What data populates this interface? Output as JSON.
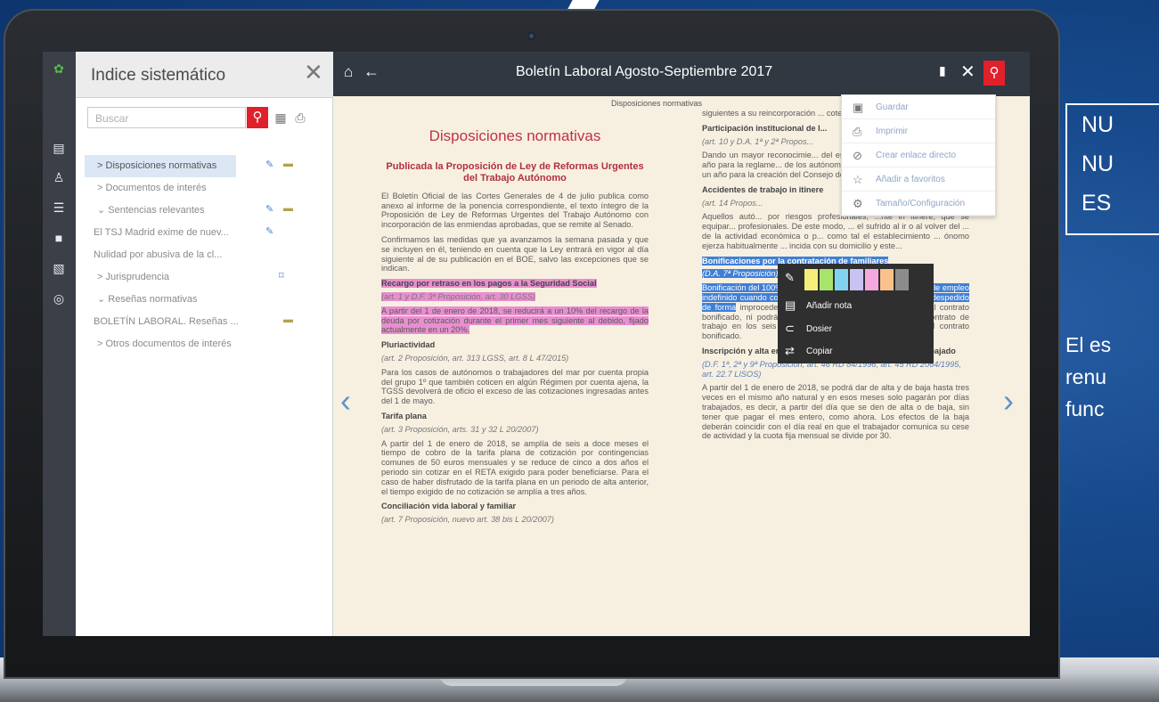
{
  "app": {
    "sidebar_title": "Indice sistemático",
    "doc_title": "Boletín Laboral Agosto-Septiembre 2017",
    "search_placeholder": "Buscar"
  },
  "tree": [
    {
      "label": "Disposiciones normativas",
      "prefix": ">"
    },
    {
      "label": "Documentos de interés",
      "prefix": ">"
    },
    {
      "label": "Sentencias relevantes",
      "prefix": "⌄"
    },
    {
      "label": "El TSJ Madrid exime de nuev...",
      "prefix": ""
    },
    {
      "label": "Nulidad por abusiva de la cl...",
      "prefix": ""
    },
    {
      "label": "Jurisprudencia",
      "prefix": ">"
    },
    {
      "label": "Reseñas normativas",
      "prefix": "⌄"
    },
    {
      "label": "BOLETÍN LABORAL. Reseñas ...",
      "prefix": ""
    },
    {
      "label": "Otros documentos de interés",
      "prefix": ">"
    }
  ],
  "doc": {
    "running_header": "Disposiciones normativas",
    "heading": "Disposiciones normativas",
    "subheading": "Publicada la Proposición de Ley de Reformas Urgentes del Trabajo Autónomo",
    "p1": "El Boletín Oficial de las Cortes Generales de 4 de julio publica como anexo al informe de la ponencia correspondiente, el texto íntegro de la Proposición de Ley de Reformas Urgentes del Trabajo Autónomo con incorporación de las enmiendas aprobadas, que se remite al Senado.",
    "p2": "Confirmamos las medidas que ya avanzamos la semana pasada y que se incluyen en él, teniendo en cuenta que la Ley entrará en vigor al día siguiente al de su publicación en el BOE, salvo las excepciones que se indican.",
    "h_recargo": "Recargo por retraso en los pagos a la Seguridad Social",
    "ref_recargo": "(art. 1 y D.F. 3ª Proposición, art. 30 LGSS)",
    "p_recargo": "A partir del 1 de enero de 2018, se reducirá a un 10% del recargo de la deuda por cotización durante el primer mes siguiente al debido, fijado actualmente en un 20%.",
    "h_pluri": "Pluriactividad",
    "ref_pluri": "(art. 2 Proposición, art. 313 LGSS, art. 8 L 47/2015)",
    "p_pluri": "Para los casos de autónomos o trabajadores del mar por cuenta propia del grupo 1º que también coticen en algún Régimen por cuenta ajena, la TGSS devolverá de oficio el exceso de las cotizaciones ingresadas antes del 1 de mayo.",
    "h_tarifa": "Tarifa plana",
    "ref_tarifa": "(art. 3 Proposición, arts. 31 y 32 L 20/2007)",
    "p_tarifa": "A partir del 1 de enero de 2018, se amplía de seis a doce meses el tiempo de cobro de la tarifa plana de cotización por contingencias comunes de 50 euros mensuales y se reduce de cinco a dos años el periodo sin cotizar en el RETA exigido para poder beneficiarse. Para el caso de haber disfrutado de la tarifa plana en un periodo de alta anterior, el tiempo exigido de no cotización se amplía a tres años.",
    "h_concil": "Conciliación vida laboral y familiar",
    "ref_concil": "(art. 7 Proposición, nuevo art. 38 bis L 20/2007)",
    "c2_top": "siguientes a su reincorporación ... coten por cotizar por base mí...",
    "h_particip": "Participación institucional de l...",
    "ref_particip": "(art. 10 y D.A. 1ª y 2ª Propos...",
    "p_particip": "Dando un mayor reconocimie... del este colectivo por las aso... dará un año para la reglame... de los autónomos en el Co... (CES). E igualmente, un año para la creación del Consejo del Trabajo Autónomo.",
    "h_accid": "Accidentes de trabajo in itinere",
    "ref_accid": "(art. 14 Propos...",
    "p_accid": "Aquellos autó... por riesgos profesionales, ...nte in itinere, que se equipar... profesionales. De este modo, ... el sufrido al ir o al volver del ... de la actividad económica o p... como tal el establecimiento ... ónomo ejerza habitualmente ... incida con su domicilio y este...",
    "h_bonif": "Bonificaciones por la contratación de familiares",
    "ref_bonif": "(D.A. 7ª Proposición)",
    "p_bonif_hl": "Bonificación del 100% durante doce meses por la contratación de empleo indefinido cuando contraten a familiares. Pero no debe haber despedido de forma",
    "p_bonif_rest": "improcedente durante los doce meses anteriores al contrato bonificado, ni podrá extinguir por las mismas causas un contrato de trabajo en los seis meses posteriores a la celebración del contrato bonificado.",
    "h_inscrip": "Inscripción y alta en la Seguridad Social y pago por día trabajado",
    "ref_inscrip": "(D.F. 1ª, 2ª y 9ª Proposición, art. 46 RD 84/1996, art. 45 RD 2064/1995, art. 22.7 LISOS)",
    "p_inscrip": "A partir del 1 de enero de 2018, se podrá dar de alta y de baja hasta tres veces en el mismo año natural y en esos meses solo pagarán por días trabajados, es decir, a partir del día que se den de alta o de baja, sin tener que pagar el mes entero, como ahora. Los efectos de la baja deberán coincidir con el día real en que el trabajador comunica su cese de actividad y la cuota fija mensual se divide por 30."
  },
  "menu": [
    {
      "label": "Guardar"
    },
    {
      "label": "Imprimir"
    },
    {
      "label": "Crear enlace directo"
    },
    {
      "label": "Añadir a favoritos"
    },
    {
      "label": "Tamaño/Configuración"
    }
  ],
  "popup": {
    "add_note": "Añadir nota",
    "dossier": "Dosier",
    "copy": "Copiar",
    "swatches": [
      "#f6ee7a",
      "#a8e36b",
      "#7fd3f0",
      "#c9c3f1",
      "#f5a8df",
      "#f9c28c",
      "#8c8c8c"
    ]
  },
  "ad": {
    "line1": "NU",
    "line2": "NU",
    "line3": "ES",
    "text1": "El es",
    "text2": "renu",
    "text3": "func"
  }
}
